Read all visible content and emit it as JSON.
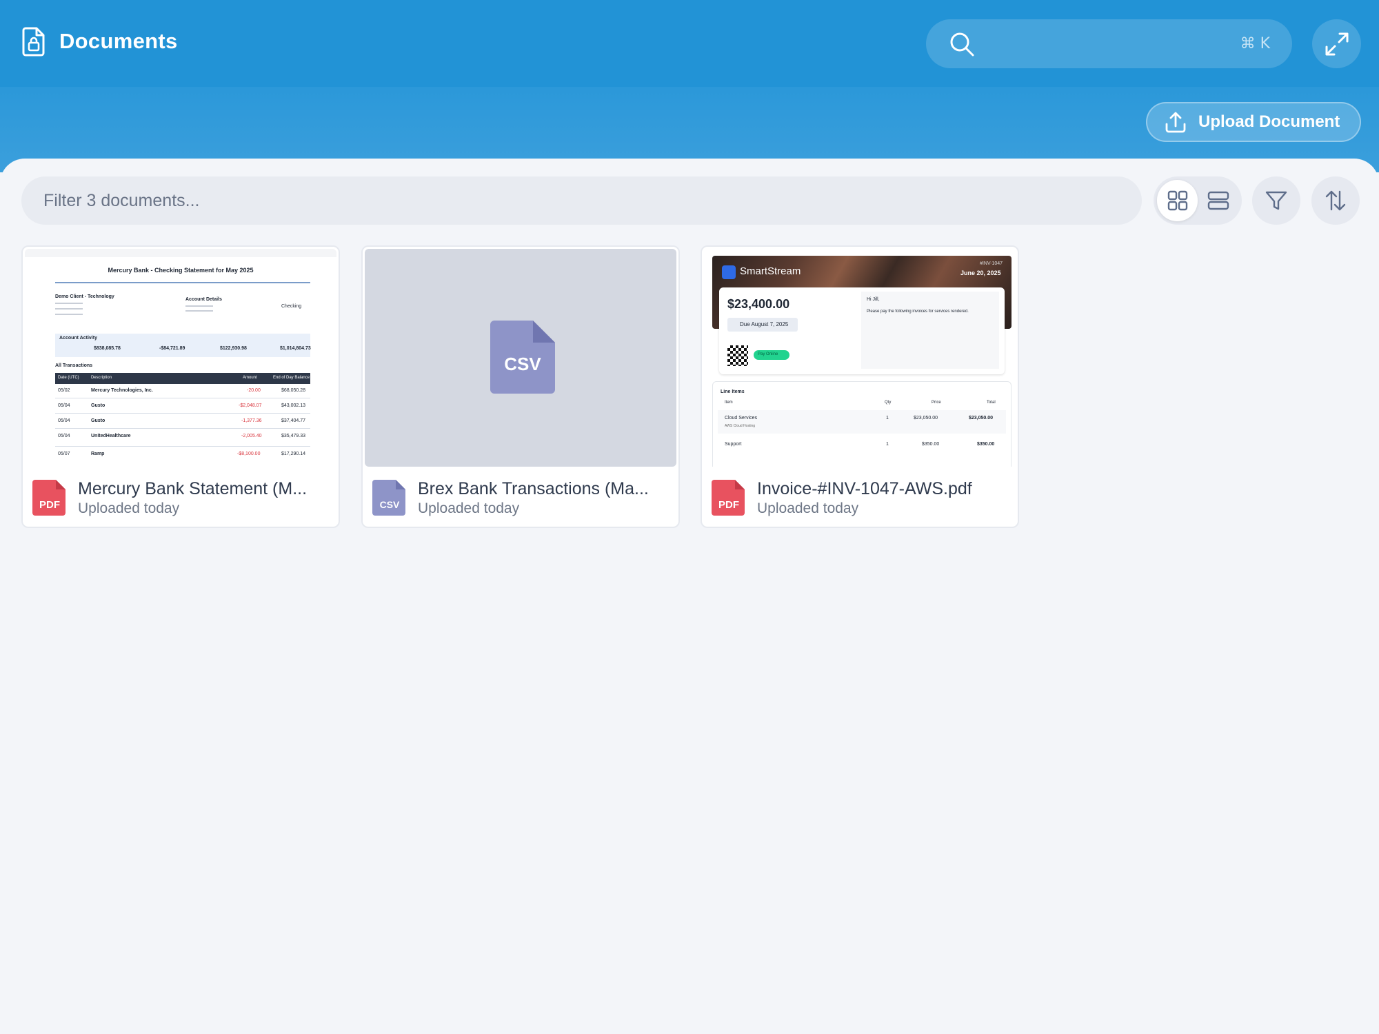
{
  "header": {
    "title": "Documents",
    "search": {
      "placeholder": "",
      "shortcut": "⌘ K"
    },
    "upload_label": "Upload Document"
  },
  "toolbar": {
    "filter_placeholder": "Filter 3 documents..."
  },
  "documents": [
    {
      "name": "Mercury Bank Statement (M...",
      "meta": "Uploaded today",
      "type_label": "PDF",
      "preview": {
        "title": "Mercury Bank - Checking Statement for May 2025",
        "client": "Demo Client - Technology",
        "account_details": "Account Details",
        "account_type": "Checking",
        "activity_label": "Account Activity",
        "beginning": "$838,085.78",
        "withdrawals": "-$84,721.89",
        "deposits": "$122,930.98",
        "ending": "$1,014,804.73",
        "transactions_label": "All Transactions",
        "columns": [
          "Date (UTC)",
          "Description",
          "Amount",
          "End of Day Balance"
        ],
        "rows": [
          [
            "05/02",
            "Mercury Technologies, Inc.",
            "-20.00",
            "$68,050.28"
          ],
          [
            "05/04",
            "Gusto",
            "-$2,048.07",
            "$43,002.13"
          ],
          [
            "05/04",
            "Gusto",
            "-1,377.36",
            "$37,404.77"
          ],
          [
            "05/04",
            "UnitedHealthcare",
            "-2,005.40",
            "$35,479.33"
          ],
          [
            "05/07",
            "Ramp",
            "-$8,100.00",
            "$17,290.14"
          ]
        ]
      }
    },
    {
      "name": "Brex Bank Transactions (Ma...",
      "meta": "Uploaded today",
      "type_label": "CSV",
      "preview": {
        "big_label": "CSV"
      }
    },
    {
      "name": "Invoice-#INV-1047-AWS.pdf",
      "meta": "Uploaded today",
      "type_label": "PDF",
      "preview": {
        "brand": "SmartStream",
        "invoice_no": "#INV-1047",
        "date": "June 20, 2025",
        "amount": "$23,400.00",
        "due": "Due August 7, 2025",
        "pay_badge": "Pay Online",
        "greeting": "Hi Jill,",
        "message": "Please pay the following invoices for services rendered.",
        "line_items_label": "Line Items",
        "columns": [
          "Item",
          "Qty",
          "Price",
          "Total"
        ],
        "items": [
          {
            "item": "Cloud Services",
            "sub": "AWS Cloud Hosting",
            "qty": "1",
            "price": "$23,050.00",
            "total": "$23,050.00"
          },
          {
            "item": "Support",
            "sub": "",
            "qty": "1",
            "price": "$350.00",
            "total": "$350.00"
          }
        ]
      }
    }
  ],
  "colors": {
    "header_blue": "#2293d6",
    "pdf_red": "#e8525f",
    "csv_purple": "#8e94c8",
    "page_bg": "#f3f5f9"
  }
}
